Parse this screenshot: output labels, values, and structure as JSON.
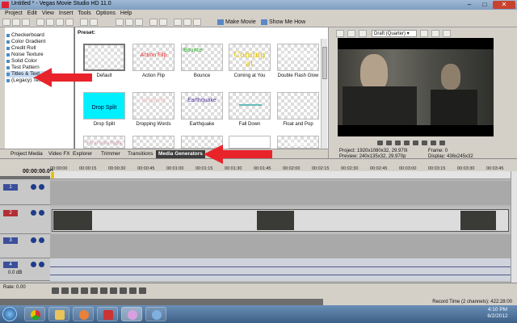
{
  "window": {
    "title": "Untitled * - Vegas Movie Studio HD 11.0",
    "min": "–",
    "max": "□",
    "close": "✕"
  },
  "menu": [
    "Project",
    "Edit",
    "View",
    "Insert",
    "Tools",
    "Options",
    "Help"
  ],
  "toolbar": {
    "make_movie": "Make Movie",
    "show_me_how": "Show Me How"
  },
  "generators": {
    "items": [
      "Checkerboard",
      "Color Gradient",
      "Credit Roll",
      "Noise Texture",
      "Solid Color",
      "Test Pattern",
      "Titles & Text",
      "(Legacy) Text"
    ],
    "selected": "Titles & Text"
  },
  "presets": {
    "label": "Preset:",
    "row1": [
      {
        "name": "Default",
        "text": "Sample Text",
        "color": "#f0f0f0"
      },
      {
        "name": "Action Flip",
        "text": "Action Flip",
        "color": "#e33"
      },
      {
        "name": "Bounce",
        "text": "Bounce",
        "color": "#2a2"
      },
      {
        "name": "Coming at You",
        "text": "Coming at",
        "color": "#e6c400"
      },
      {
        "name": "Double Flash Glow",
        "text": "Double Flash",
        "color": "#666"
      }
    ],
    "row2": [
      {
        "name": "Drop Split",
        "text": "Drop Split",
        "color": "#003"
      },
      {
        "name": "Dropping Words",
        "text": "Dropping",
        "color": "#f4c0c0"
      },
      {
        "name": "Earthquake",
        "text": "Earthquake",
        "color": "#5a3fa6"
      },
      {
        "name": "Fall Down",
        "text": "",
        "color": "#6bb"
      },
      {
        "name": "Float and Pop",
        "text": "",
        "color": "#999"
      }
    ],
    "row3": [
      {
        "text": "Fly in from Right",
        "color": "#c9a"
      },
      {
        "text": "",
        "color": "#888"
      },
      {
        "text": "",
        "color": "#888"
      },
      {
        "text": "",
        "color": "#888"
      },
      {
        "text": "Popup",
        "color": "#fff"
      }
    ]
  },
  "tabs": [
    "Project Media",
    "Video FX",
    "Explorer",
    "Trimmer",
    "Transitions",
    "Media Generators"
  ],
  "active_tab": "Media Generators",
  "preview": {
    "quality": "Draft (Quarter)",
    "project_label": "Project:",
    "project_value": "1920x1080x32, 29.970i",
    "preview_label": "Preview:",
    "preview_value": "240x135x32, 29.970p",
    "frame_label": "Frame:",
    "frame_value": "0",
    "display_label": "Display:",
    "display_value": "436x245x32"
  },
  "timeline": {
    "timecode": "00:00:00.00",
    "ruler_ticks": [
      "00:00:00",
      "00:00:15",
      "00:00:30",
      "00:00:45",
      "00:01:00",
      "00:01:15",
      "00:01:30",
      "00:01:45",
      "00:02:00",
      "00:02:15",
      "00:02:30",
      "00:02:45",
      "00:03:00",
      "00:03:15",
      "00:03:30",
      "00:03:45"
    ],
    "tracks": [
      {
        "num": "1"
      },
      {
        "num": "2"
      },
      {
        "num": "3"
      },
      {
        "num": "4",
        "level": "0.0 dB"
      }
    ]
  },
  "transport": {
    "rate": "Rate: 0.00"
  },
  "status": {
    "record_time": "Record Time (2 channels): 422:28:00"
  },
  "taskbar": {
    "time": "4:10 PM",
    "date": "6/2/2012"
  },
  "colors": {
    "accent_red": "#e8232a",
    "title_bar": "#9fbad7",
    "taskbar": "#3c5f86"
  }
}
